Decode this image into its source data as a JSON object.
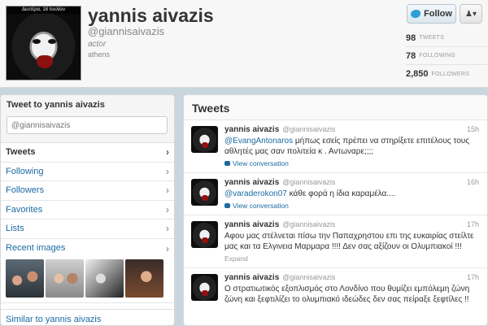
{
  "profile": {
    "avatar_caption": "Δευτέρα, 18 Ιουλίου",
    "name": "yannis aivazis",
    "screen_name": "@giannisaivazis",
    "bio": "actor",
    "location": "athens"
  },
  "actions": {
    "follow_label": "Follow",
    "user_menu_icon": "user-menu-icon"
  },
  "stats": [
    {
      "count": "98",
      "label": "TWEETS"
    },
    {
      "count": "78",
      "label": "FOLLOWING"
    },
    {
      "count": "2,850",
      "label": "FOLLOWERS"
    }
  ],
  "tweet_to": {
    "title": "Tweet to yannis aivazis",
    "placeholder": "@giannisaivazis"
  },
  "nav": {
    "items": [
      {
        "label": "Tweets"
      },
      {
        "label": "Following"
      },
      {
        "label": "Followers"
      },
      {
        "label": "Favorites"
      },
      {
        "label": "Lists"
      }
    ],
    "recent_images": "Recent images",
    "similar": "Similar to yannis aivazis"
  },
  "stream": {
    "title": "Tweets",
    "tweets": [
      {
        "name": "yannis aivazis",
        "handle": "@giannisaivazis",
        "time": "15h",
        "mention": "@EvangAntonaros",
        "text": " μήπως εσείς πρέπει να στηρίξετε επιτέλους τους αθλητές μας σαν πολιτεία κ . Αντωναρε;;;;",
        "action": "View conversation"
      },
      {
        "name": "yannis aivazis",
        "handle": "@giannisaivazis",
        "time": "16h",
        "mention": "@varaderokon07",
        "text": " κάθε φορά η ίδια καραμέλα....",
        "action": "View conversation"
      },
      {
        "name": "yannis aivazis",
        "handle": "@giannisaivazis",
        "time": "17h",
        "text": "Αφου μας στέλνεται πίσω την Παπαχρηστου επι της ευκαιρίας στείλτε μας και τα Ελγινεια Μαρμαρα !!!! Δεν σας αξίζουν οι Ολυμπιακοί !!!",
        "action": "Expand"
      },
      {
        "name": "yannis aivazis",
        "handle": "@giannisaivazis",
        "time": "17h",
        "text": "Ο στρατιωτικός εξοπλισμός στο Λονδίνο που θυμίζει εμπόλεμη ζώνη ζώνη και ξεφτιλίζει το ολυμπιακό ιδεώδες δεν σας πείραξε ξεφτίλες !!"
      }
    ]
  },
  "colors": {
    "link": "#1b6ba3",
    "background": "#c9d6de"
  }
}
